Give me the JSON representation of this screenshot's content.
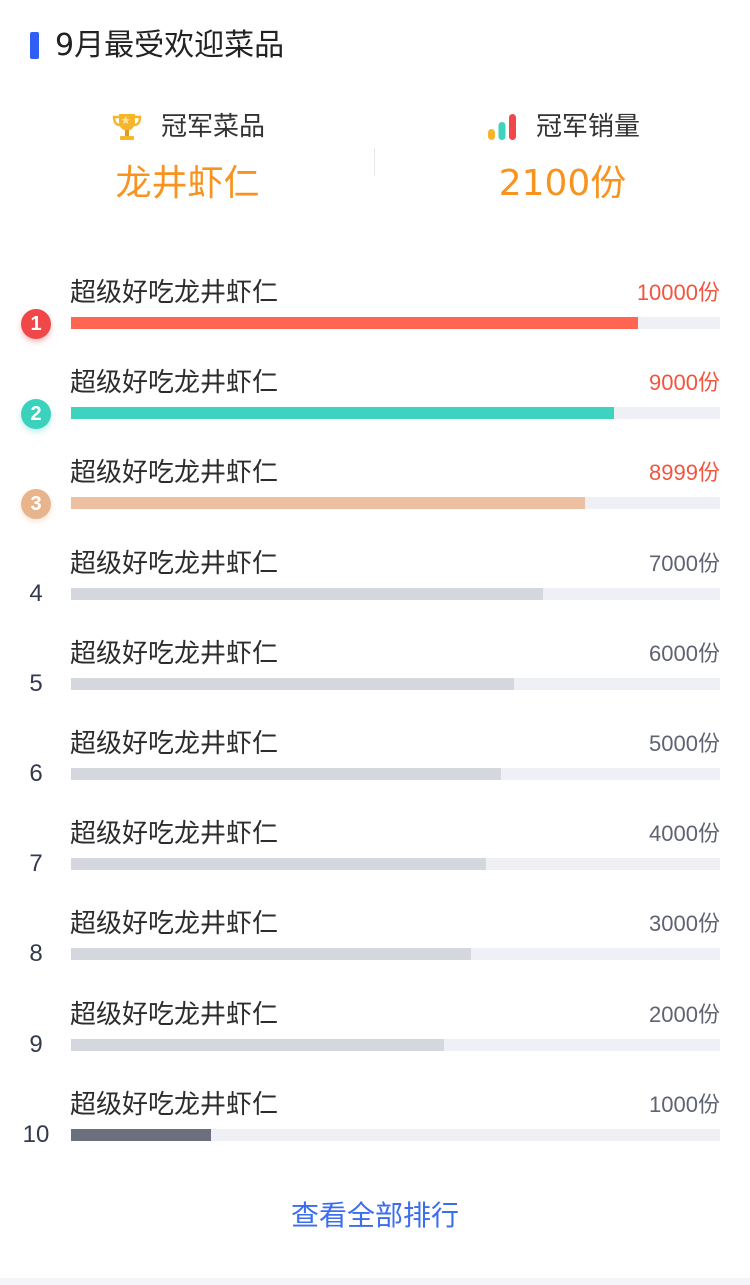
{
  "header": {
    "title": "9月最受欢迎菜品",
    "accent_color": "#2f5ff5"
  },
  "summary": {
    "dish": {
      "icon": "trophy-icon",
      "label": "冠军菜品",
      "value": "龙井虾仁"
    },
    "sales": {
      "icon": "bar-chart-icon",
      "label": "冠军销量",
      "value": "2100份"
    },
    "value_color": "#f7931e"
  },
  "ranking": {
    "unit": "份",
    "max_value": 11500,
    "items": [
      {
        "rank": "1",
        "name": "超级好吃龙井虾仁",
        "value": 10000,
        "value_label": "10000份",
        "color": "#fe6651"
      },
      {
        "rank": "2",
        "name": "超级好吃龙井虾仁",
        "value": 9000,
        "value_label": "9000份",
        "color": "#3dd3be"
      },
      {
        "rank": "3",
        "name": "超级好吃龙井虾仁",
        "value": 8999,
        "value_label": "8999份",
        "color": "#ecc0a0"
      },
      {
        "rank": "4",
        "name": "超级好吃龙井虾仁",
        "value": 7000,
        "value_label": "7000份",
        "color": "#d5d7de"
      },
      {
        "rank": "5",
        "name": "超级好吃龙井虾仁",
        "value": 6000,
        "value_label": "6000份",
        "color": "#d5d7de"
      },
      {
        "rank": "6",
        "name": "超级好吃龙井虾仁",
        "value": 5000,
        "value_label": "5000份",
        "color": "#d5d7de"
      },
      {
        "rank": "7",
        "name": "超级好吃龙井虾仁",
        "value": 4000,
        "value_label": "4000份",
        "color": "#d5d7de"
      },
      {
        "rank": "8",
        "name": "超级好吃龙井虾仁",
        "value": 3000,
        "value_label": "3000份",
        "color": "#d5d7de"
      },
      {
        "rank": "9",
        "name": "超级好吃龙井虾仁",
        "value": 2000,
        "value_label": "2000份",
        "color": "#d5d7de"
      },
      {
        "rank": "10",
        "name": "超级好吃龙井虾仁",
        "value": 1000,
        "value_label": "1000份",
        "color": "#6c6f7e"
      }
    ],
    "fill_fraction": [
      0.873,
      0.837,
      0.792,
      0.727,
      0.682,
      0.662,
      0.639,
      0.617,
      0.575,
      0.215
    ],
    "track_color": "#eff0f5",
    "hot_value_color": "#f2553f"
  },
  "footer": {
    "view_all": "查看全部排行"
  }
}
